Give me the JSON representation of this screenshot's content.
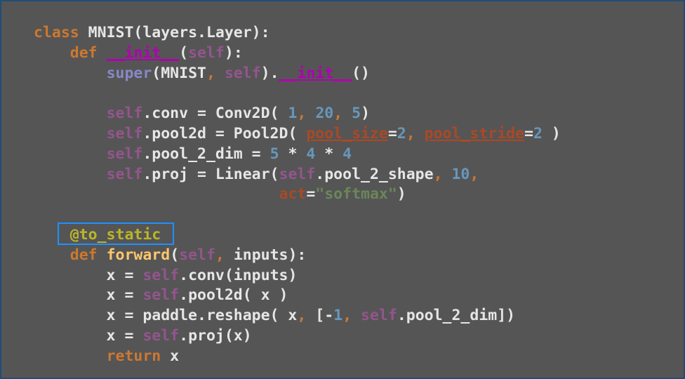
{
  "code": {
    "language": "python",
    "lines": [
      "class MNIST(layers.Layer):",
      "    def __init__(self):",
      "        super(MNIST, self).__init__()",
      "",
      "        self.conv = Conv2D( 1, 20, 5)",
      "        self.pool2d = Pool2D( pool_size=2, pool_stride=2 )",
      "        self.pool_2_dim = 5 * 4 * 4",
      "        self.proj = Linear(self.pool_2_shape, 10,",
      "                           act=\"softmax\")",
      "",
      "    @to_static",
      "    def forward(self, inputs):",
      "        x = self.conv(inputs)",
      "        x = self.pool2d( x )",
      "        x = paddle.reshape( x, [-1, self.pool_2_dim])",
      "        x = self.proj(x)",
      "        return x"
    ],
    "highlighted_token": "@to_static"
  },
  "colors": {
    "background": "#555555",
    "keyword": "#cc7832",
    "self": "#94558d",
    "number": "#6897bb",
    "parameter": "#aa4926",
    "string": "#6a8759",
    "builtin": "#8888c6",
    "function_name": "#ffc66d",
    "decorator": "#bbb529",
    "dunder": "#b200b2",
    "highlight_box": "#1e90ff"
  }
}
